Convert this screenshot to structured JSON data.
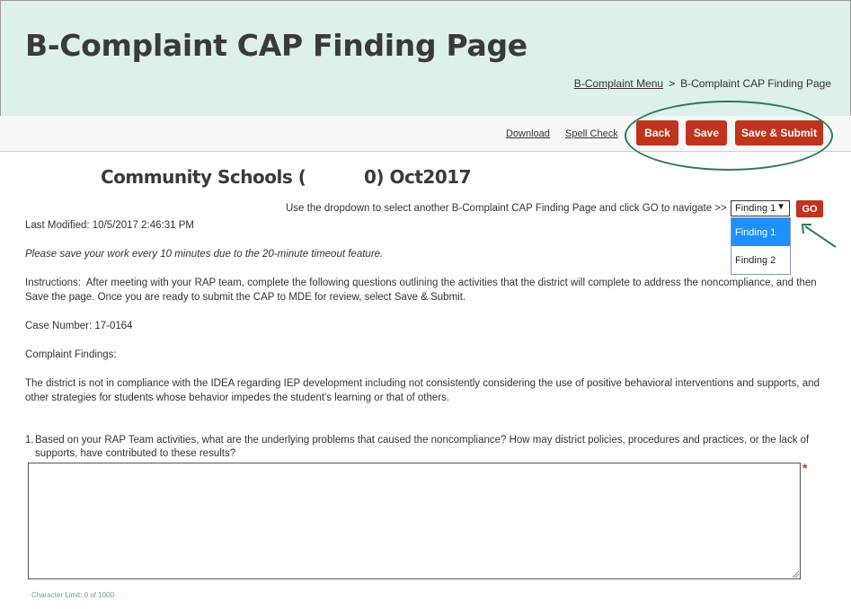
{
  "header": {
    "title": "B-Complaint CAP Finding Page",
    "breadcrumb": {
      "menu_link": "B-Complaint Menu",
      "separator": ">",
      "current": "B-Complaint CAP Finding Page"
    }
  },
  "toolbar": {
    "download": "Download",
    "spell_check": "Spell Check",
    "back": "Back",
    "save": "Save",
    "save_submit": "Save & Submit"
  },
  "district": {
    "heading": "Community Schools (          0) Oct2017"
  },
  "navigation": {
    "hint": "Use the dropdown to select another B-Complaint CAP Finding Page and click GO to navigate >>",
    "selected": "Finding 1",
    "options": [
      "Finding 1",
      "Finding 2"
    ],
    "go": "GO"
  },
  "content": {
    "last_modified": "Last Modified: 10/5/2017 2:46:31 PM",
    "timeout_note": "Please save your work every 10 minutes due to the 20-minute timeout feature.",
    "instructions_label": "Instructions:",
    "instructions_part1": "After meeting with your RAP team, complete the following questions outlining the activities that the district will complete to address the noncompliance, and then",
    "instructions_save": "Save",
    "instructions_part2": "the page. Once you are ready to submit the CAP to MDE for review, select",
    "instructions_save_submit": "Save & Submit",
    "instructions_end": ".",
    "case_number": "Case Number: 17-0164",
    "findings_label": "Complaint Findings:",
    "findings_text": "The district is not in compliance with the IDEA regarding IEP development including not consistently considering the use of positive behavioral interventions and supports, and other strategies for students whose behavior impedes the student's learning or that of others."
  },
  "question": {
    "number": "1.",
    "text": "Based on your RAP Team activities, what are the underlying problems that caused the noncompliance? How may district policies, procedures and practices, or the lack of supports, have contributed to these results?",
    "value": "",
    "required_mark": "*",
    "char_limit": "Character Limit: 0 of 1000"
  },
  "colors": {
    "header_bg": "#ddf0ec",
    "button_red": "#c0341d",
    "annotation_green": "#2d7a5c",
    "highlight_blue": "#1e90ff"
  }
}
